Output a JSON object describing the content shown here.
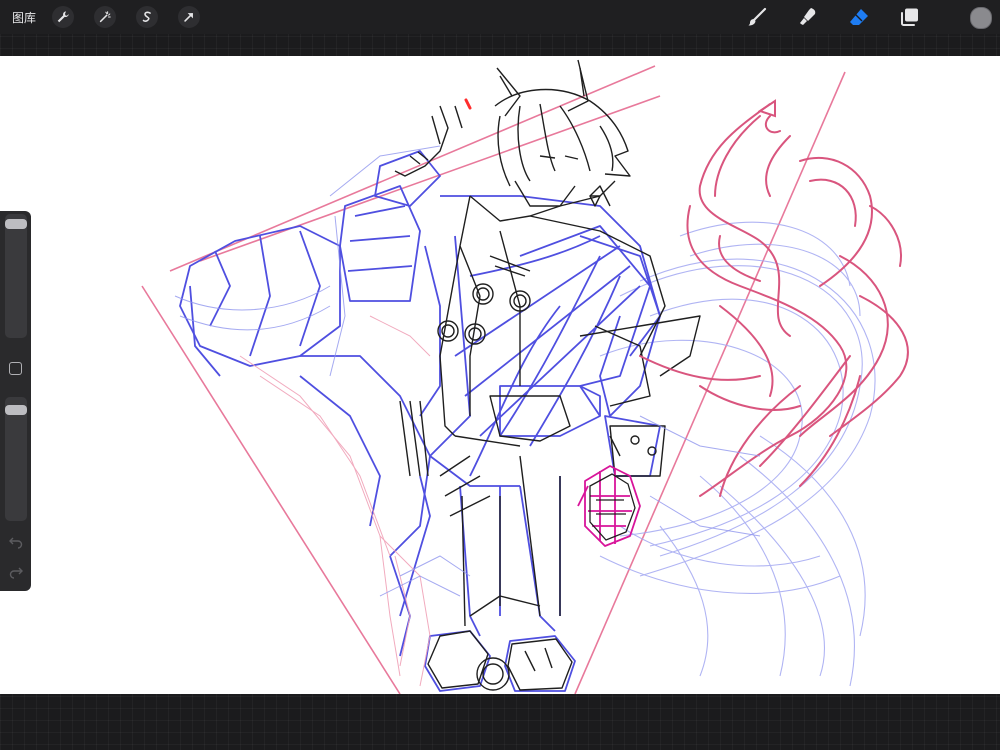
{
  "toolbar": {
    "gallery_label": "图库",
    "left_icons": [
      "wrench-icon",
      "magic-wand-icon",
      "selection-icon",
      "transform-arrow-icon"
    ],
    "right_tools": [
      "brush-icon",
      "smudge-icon",
      "eraser-icon",
      "layers-icon"
    ],
    "active_tool": "eraser-icon",
    "active_color": "#1e7cf2",
    "current_color": "#8a8a8e"
  },
  "sidebar": {
    "brush_size_level": 0.97,
    "brush_opacity_level": 0.95
  },
  "canvas": {
    "background": "#ffffff",
    "sketch_colors": {
      "ink": "#222222",
      "blue_rough": "#4a4ae0",
      "light_blue_rough": "#9a9ff0",
      "pink_guides": "#e8799b",
      "pink_tail": "#d9557e",
      "magenta_fist": "#d8149a"
    }
  }
}
